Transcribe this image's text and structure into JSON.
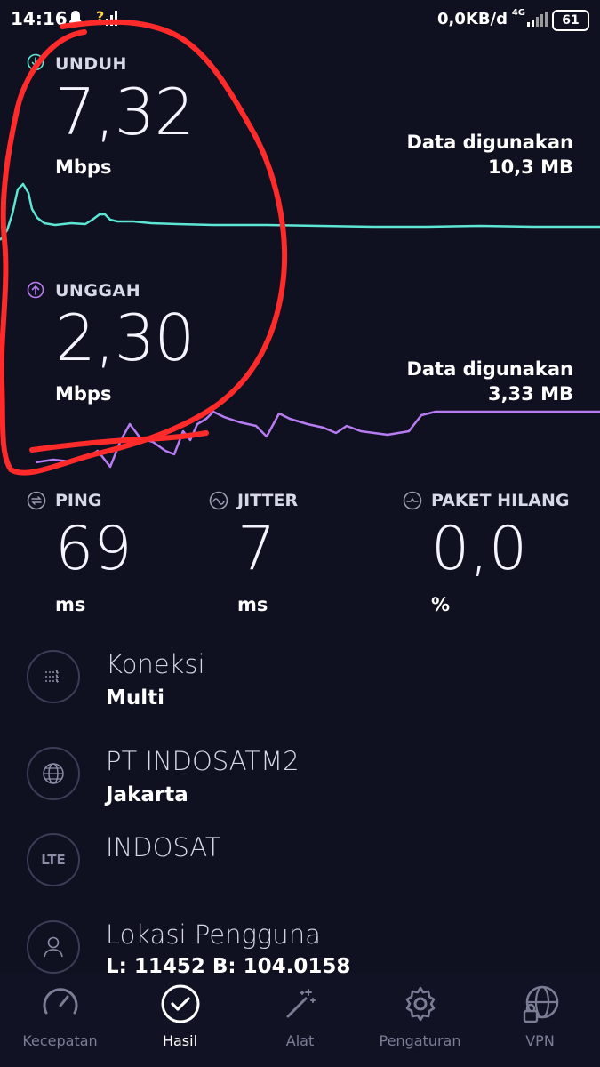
{
  "status_bar": {
    "time": "14:16",
    "data_rate": "0,0KB/d",
    "network": "4G",
    "battery": "61"
  },
  "download": {
    "label": "UNDUH",
    "value": "7,32",
    "unit": "Mbps",
    "used_title": "Data digunakan",
    "used_value": "10,3 MB",
    "color": "#5ee6d5"
  },
  "upload": {
    "label": "UNGGAH",
    "value": "2,30",
    "unit": "Mbps",
    "used_title": "Data digunakan",
    "used_value": "3,33 MB",
    "color": "#b67cf0"
  },
  "stats": {
    "ping": {
      "label": "PING",
      "value": "69",
      "unit": "ms"
    },
    "jitter": {
      "label": "JITTER",
      "value": "7",
      "unit": "ms"
    },
    "packet_loss": {
      "label": "PAKET HILANG",
      "value": "0,0",
      "unit": "%"
    }
  },
  "info": {
    "connection": {
      "title": "Koneksi",
      "value": "Multi"
    },
    "provider": {
      "title": "PT INDOSATM2",
      "value": "Jakarta"
    },
    "network": {
      "title": "INDOSAT",
      "icon_text": "LTE"
    },
    "location": {
      "title": "Lokasi Pengguna",
      "value": "L: 11452 B: 104.0158"
    }
  },
  "nav": {
    "speed": "Kecepatan",
    "results": "Hasil",
    "tools": "Alat",
    "settings": "Pengaturan",
    "vpn": "VPN"
  },
  "annotation_color": "#ff2a2a"
}
